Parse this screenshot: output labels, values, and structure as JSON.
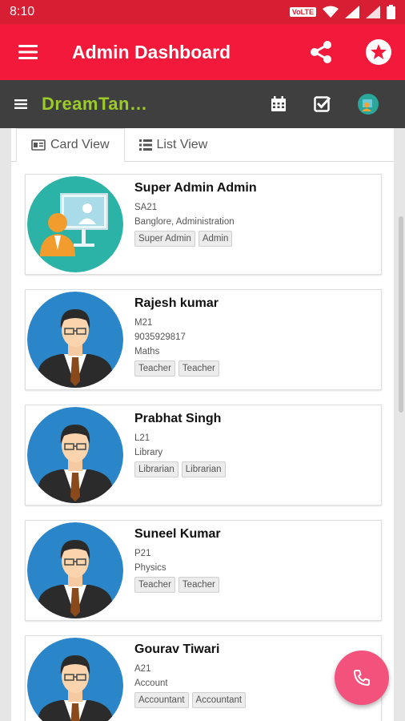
{
  "status": {
    "time": "8:10",
    "volte": "VoLTE"
  },
  "appbar": {
    "title": "Admin Dashboard"
  },
  "subbar": {
    "brand": "DreamTan…"
  },
  "tabs": [
    {
      "label": "Card View",
      "icon": "id-card-icon",
      "active": true
    },
    {
      "label": "List View",
      "icon": "list-icon",
      "active": false
    }
  ],
  "people": [
    {
      "name": "Super Admin Admin",
      "lines": [
        "SA21",
        "Banglore, Administration"
      ],
      "tags": [
        "Super Admin",
        "Admin"
      ],
      "avatar": "admin-presenter-avatar"
    },
    {
      "name": "Rajesh kumar",
      "lines": [
        "M21",
        "9035929817",
        "Maths"
      ],
      "tags": [
        "Teacher",
        "Teacher"
      ],
      "avatar": "man-suit-avatar"
    },
    {
      "name": "Prabhat Singh",
      "lines": [
        "L21",
        "Library"
      ],
      "tags": [
        "Librarian",
        "Librarian"
      ],
      "avatar": "man-suit-avatar"
    },
    {
      "name": "Suneel Kumar",
      "lines": [
        "P21",
        "Physics"
      ],
      "tags": [
        "Teacher",
        "Teacher"
      ],
      "avatar": "man-suit-avatar"
    },
    {
      "name": "Gourav Tiwari",
      "lines": [
        "A21",
        "Account"
      ],
      "tags": [
        "Accountant",
        "Accountant"
      ],
      "avatar": "man-suit-avatar"
    }
  ],
  "colors": {
    "statusbar": "#d81e32",
    "appbar": "#f2193a",
    "subbar": "#3f3f3f",
    "brand": "#9ccb29",
    "fab": "#f2527b"
  }
}
